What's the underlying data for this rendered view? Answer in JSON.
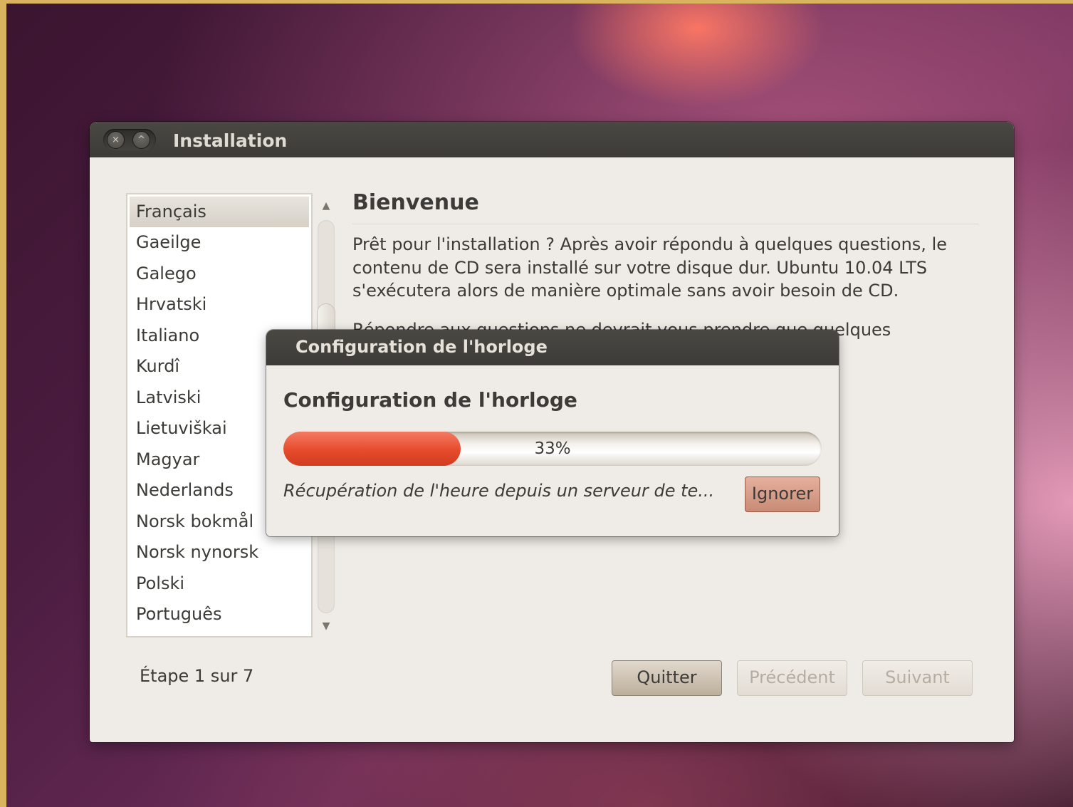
{
  "window": {
    "title": "Installation",
    "close_glyph": "×",
    "minimize_glyph": "^"
  },
  "languages": {
    "items": [
      "Français",
      "Gaeilge",
      "Galego",
      "Hrvatski",
      "Italiano",
      "Kurdî",
      "Latviski",
      "Lietuviškai",
      "Magyar",
      "Nederlands",
      "Norsk bokmål",
      "Norsk nynorsk",
      "Polski",
      "Português"
    ],
    "selected": "Français",
    "scroll_up_glyph": "▲",
    "scroll_down_glyph": "▼"
  },
  "welcome": {
    "title": "Bienvenue",
    "text": "Prêt pour l'installation ? Après avoir répondu à quelques questions, le contenu de CD sera installé sur votre disque dur. Ubuntu 10.04 LTS s'exécutera alors de manière optimale sans avoir besoin de CD.",
    "text2": "Répondre aux questions ne devrait vous prendre que quelques"
  },
  "footer": {
    "step": "Étape 1 sur 7",
    "quit_label": "Quitter",
    "prev_label": "Précédent",
    "next_label": "Suivant"
  },
  "dialog": {
    "title": "Configuration de l'horloge",
    "heading": "Configuration de l'horloge",
    "progress_label": "33%",
    "progress_value": 0.33,
    "status": "Récupération de l'heure depuis un serveur de te...",
    "ignore_label": "Ignorer"
  },
  "colors": {
    "accent": "#e64b2d",
    "titlebar": "#3c3b37",
    "window_bg": "#efebe6"
  }
}
